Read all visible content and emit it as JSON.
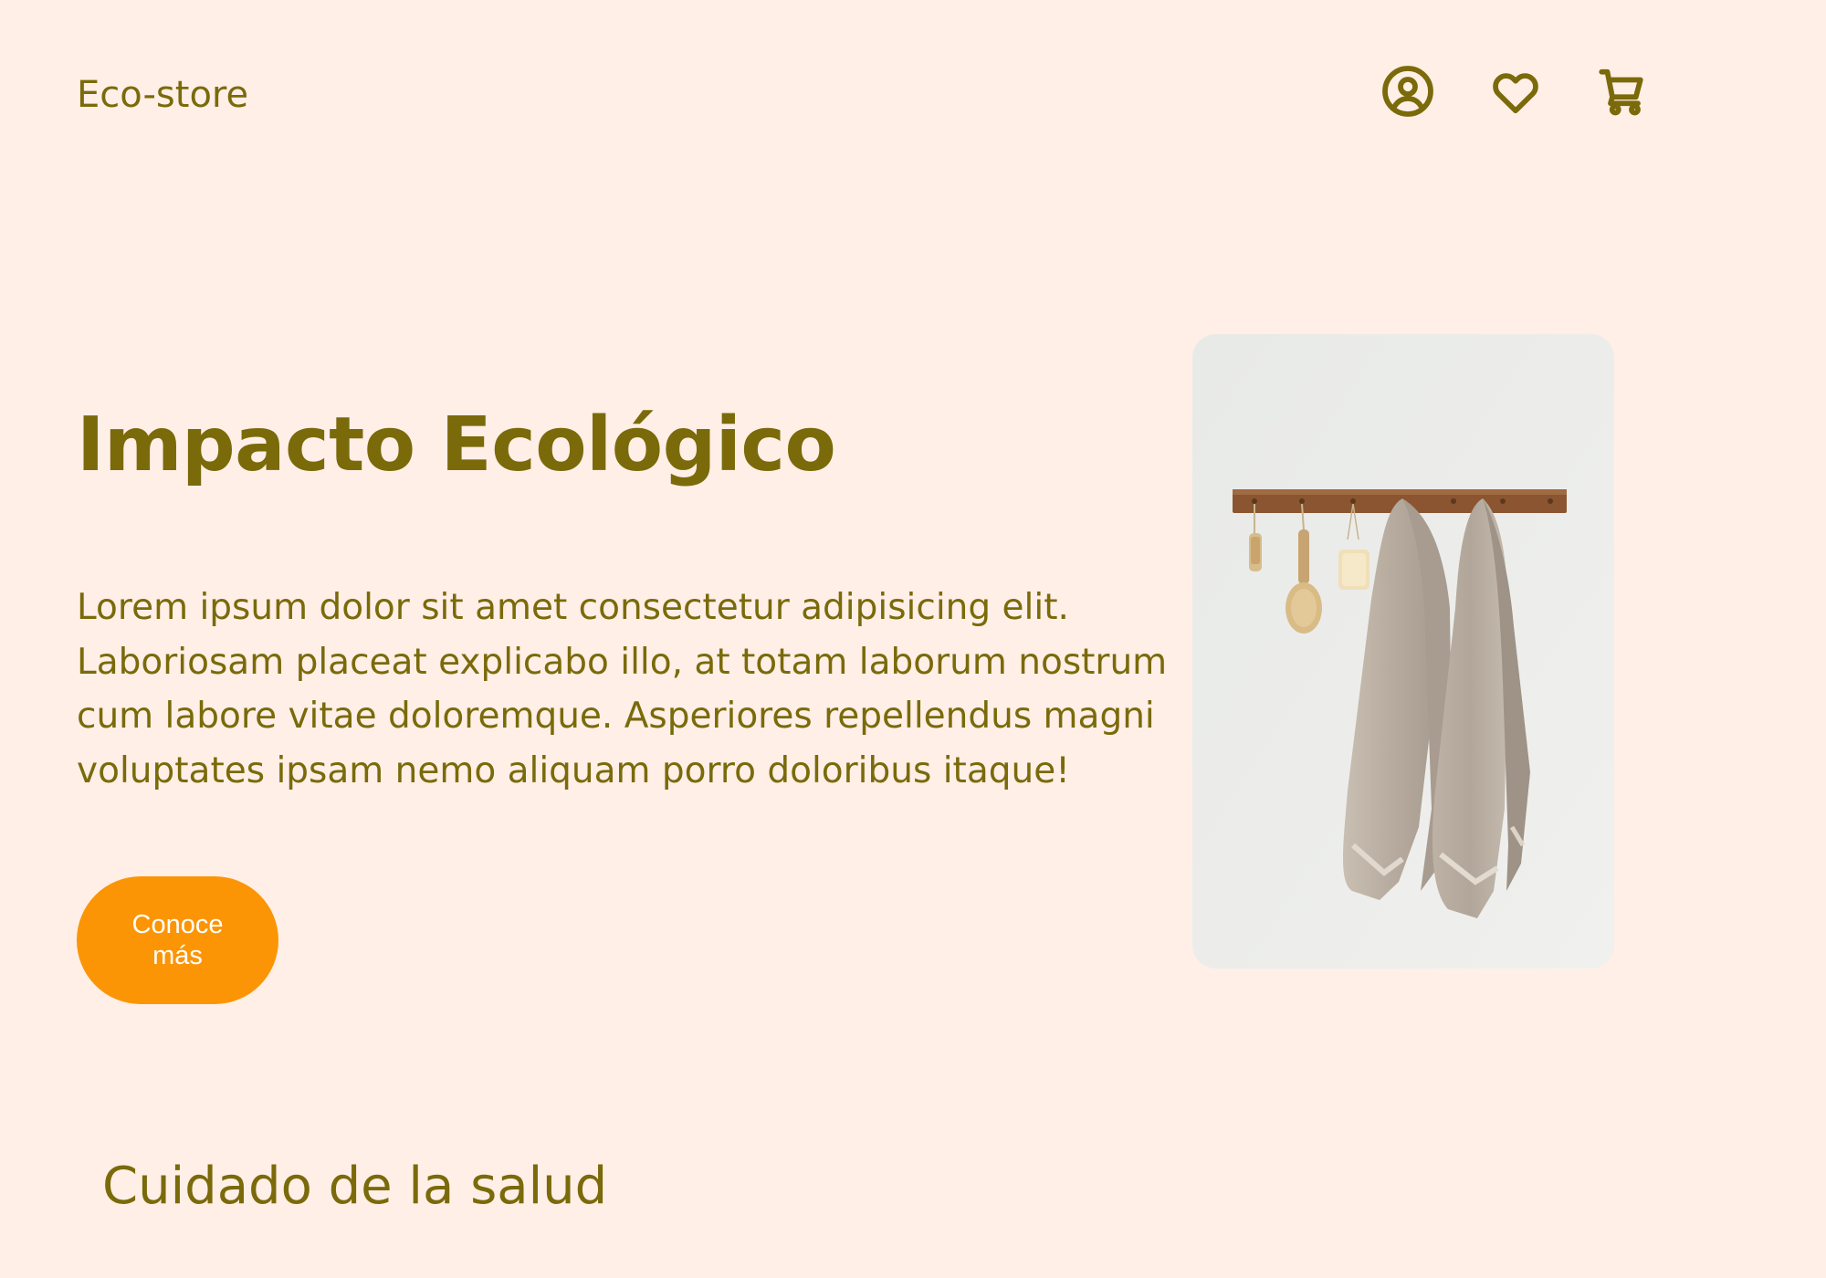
{
  "header": {
    "logo": "Eco-store",
    "icons": [
      "user-account-icon",
      "heart-icon",
      "shopping-cart-icon"
    ]
  },
  "hero": {
    "title": "Impacto Ecológico",
    "description": "Lorem ipsum dolor sit amet consectetur adipisicing elit. Laboriosam placeat explicabo illo, at totam laborum nostrum cum labore vitae doloremque. Asperiores repellendus magni voluptates ipsam nemo aliquam porro doloribus itaque!",
    "cta_label": "Conoce más",
    "image": "towels-on-wooden-hook-rack"
  },
  "sections": {
    "next_title": "Cuidado de la salud"
  },
  "colors": {
    "background": "#ffefe7",
    "text": "#7a6a0a",
    "accent": "#fb9505",
    "button_text": "#ffffff"
  }
}
